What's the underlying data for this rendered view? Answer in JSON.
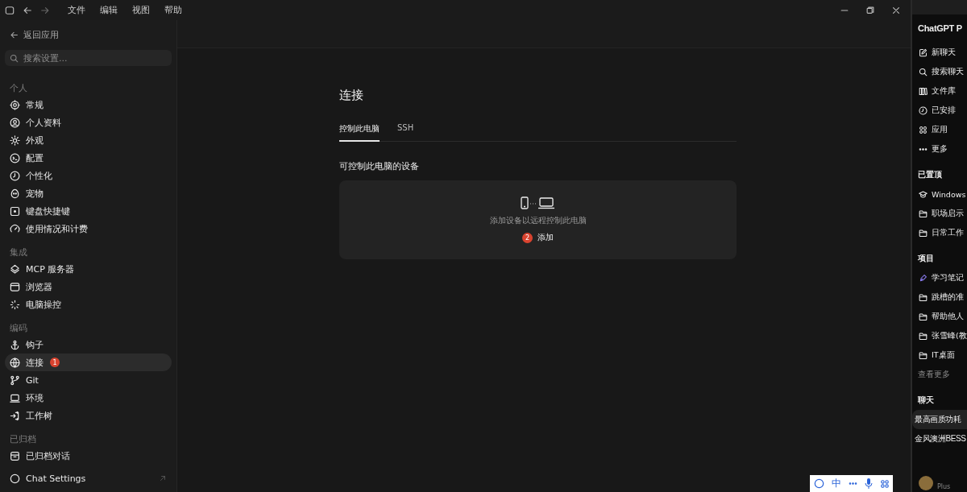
{
  "window": {
    "menu": [
      "文件",
      "编辑",
      "视图",
      "帮助"
    ]
  },
  "sidebar": {
    "back": "返回应用",
    "search": {
      "placeholder": "搜索设置..."
    },
    "sections": [
      {
        "title": "个人",
        "items": [
          {
            "label": "常规",
            "selected": false
          },
          {
            "label": "个人资料",
            "selected": false
          },
          {
            "label": "外观",
            "selected": false
          },
          {
            "label": "配置",
            "selected": false
          },
          {
            "label": "个性化",
            "selected": false
          },
          {
            "label": "宠物",
            "selected": false
          },
          {
            "label": "键盘快捷键",
            "selected": false
          },
          {
            "label": "使用情况和计费",
            "selected": false
          }
        ]
      },
      {
        "title": "集成",
        "items": [
          {
            "label": "MCP 服务器",
            "selected": false
          },
          {
            "label": "浏览器",
            "selected": false
          },
          {
            "label": "电脑操控",
            "selected": false
          }
        ]
      },
      {
        "title": "编码",
        "items": [
          {
            "label": "钩子",
            "selected": false
          },
          {
            "label": "连接",
            "selected": true,
            "badge": "1"
          },
          {
            "label": "Git",
            "selected": false
          },
          {
            "label": "环境",
            "selected": false
          },
          {
            "label": "工作树",
            "selected": false
          }
        ]
      },
      {
        "title": "已归档",
        "items": [
          {
            "label": "已归档对话",
            "selected": false
          }
        ]
      }
    ],
    "footer": "Chat Settings"
  },
  "main": {
    "title": "连接",
    "tabs": [
      {
        "label": "控制此电脑",
        "selected": true
      },
      {
        "label": "SSH",
        "selected": false
      }
    ],
    "heading": "可控制此电脑的设备",
    "card": {
      "message": "添加设备以远程控制此电脑",
      "action": "添加",
      "action_badge": "2"
    }
  },
  "chat_panel": {
    "title": "ChatGPT P",
    "nav": [
      "新聊天",
      "搜索聊天",
      "文件库",
      "已安排",
      "应用",
      "更多"
    ],
    "pinned": {
      "title": "已置顶",
      "items": [
        "Windows",
        "职场启示",
        "日常工作"
      ]
    },
    "projects": {
      "title": "项目",
      "items": [
        "学习笔记",
        "跳槽的准",
        "帮助他人",
        "张雪峰(教",
        "IT桌面"
      ],
      "more": "查看更多"
    },
    "chats": {
      "title": "聊天",
      "items": [
        {
          "label": "最高画质功耗",
          "selected": true
        },
        {
          "label": "金风澳洲BESS",
          "selected": false
        }
      ]
    },
    "plan": "Plus"
  },
  "ime": {
    "mode": "中"
  }
}
